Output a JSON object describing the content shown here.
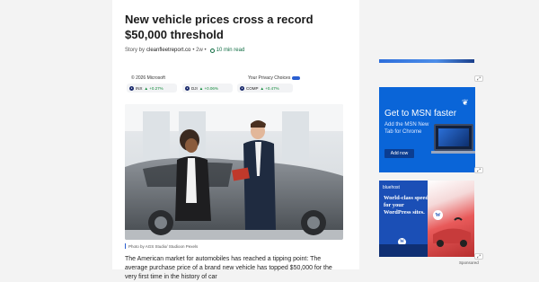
{
  "article": {
    "title": "New vehicle prices cross a record $50,000 threshold",
    "byline": {
      "prefix": "Story by",
      "source": "cleanfleetreport.co",
      "age": "• 2w •",
      "read_time": "10 min read"
    },
    "ticker": {
      "copyright": "© 2026 Microsoft",
      "privacy": "Your Privacy Choices",
      "items": [
        {
          "symbol": "INX",
          "change": "▲ +0.27%"
        },
        {
          "symbol": "DJI",
          "change": "▲ +0.06%"
        },
        {
          "symbol": "COMP",
          "change": "▲ +0.47%"
        }
      ]
    },
    "photo_caption": "Photo by AGS Studio/ Studioon Pexels",
    "body": "The American market for automobiles has reached a tipping point: The average purchase price of a brand new vehicle has topped $50,000 for the very first time in the history of car"
  },
  "sidebar": {
    "ad_controls": {
      "expand_icon": "expand-icon",
      "close": "✕"
    },
    "msn_ad": {
      "headline": "Get to MSN faster",
      "text": "Add the MSN New Tab for Chrome",
      "button": "Add now"
    },
    "bluehost_ad": {
      "logo": "bluehost",
      "headline": "World-class speed for your WordPress sites."
    },
    "sponsored": "Sponsored"
  },
  "colors": {
    "msn_blue": "#0a65d8",
    "bluehost_blue": "#1b4fb6",
    "positive_green": "#118a3a",
    "read_green": "#0f6c42"
  }
}
